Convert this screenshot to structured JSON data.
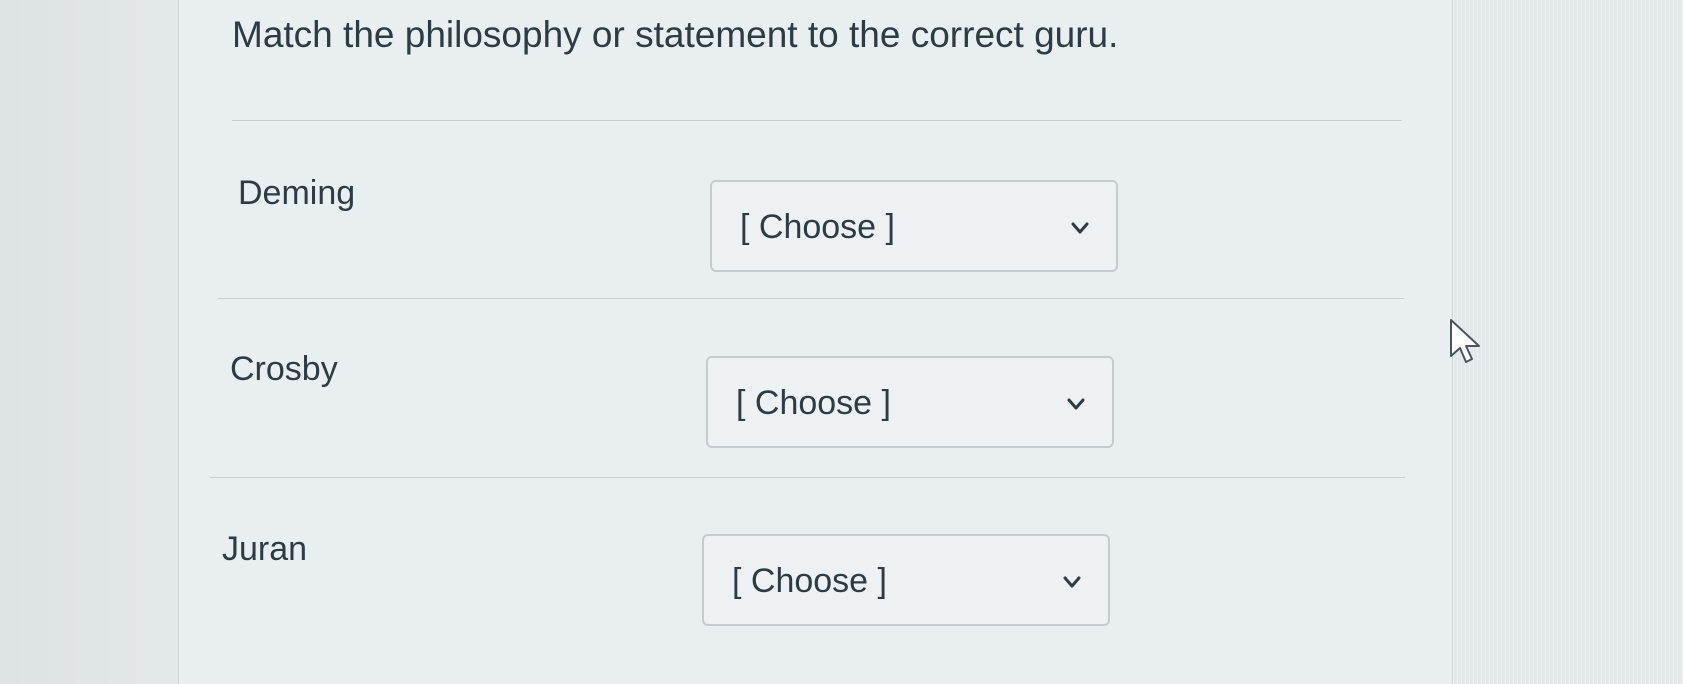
{
  "question": {
    "text": "Match the philosophy or statement to the correct guru."
  },
  "answers": [
    {
      "label": "Deming",
      "selected": "[ Choose ]",
      "icon": "chevron-down-icon"
    },
    {
      "label": "Crosby",
      "selected": "[ Choose ]",
      "icon": "chevron-down-icon"
    },
    {
      "label": "Juran",
      "selected": "[ Choose ]",
      "icon": "chevron-down-icon"
    }
  ],
  "cursor": {
    "icon": "mouse-pointer-icon"
  },
  "colors": {
    "text": "#2d3b45",
    "panel": "#e9eef1",
    "border": "#c4ccd1"
  }
}
